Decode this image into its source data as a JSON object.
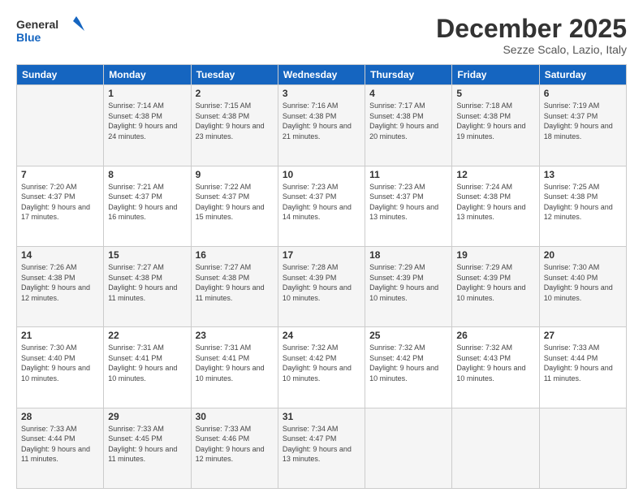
{
  "logo": {
    "line1": "General",
    "line2": "Blue"
  },
  "header": {
    "month": "December 2025",
    "location": "Sezze Scalo, Lazio, Italy"
  },
  "weekdays": [
    "Sunday",
    "Monday",
    "Tuesday",
    "Wednesday",
    "Thursday",
    "Friday",
    "Saturday"
  ],
  "weeks": [
    [
      {
        "day": null
      },
      {
        "day": 1,
        "sunrise": "7:14 AM",
        "sunset": "4:38 PM",
        "daylight": "9 hours and 24 minutes."
      },
      {
        "day": 2,
        "sunrise": "7:15 AM",
        "sunset": "4:38 PM",
        "daylight": "9 hours and 23 minutes."
      },
      {
        "day": 3,
        "sunrise": "7:16 AM",
        "sunset": "4:38 PM",
        "daylight": "9 hours and 21 minutes."
      },
      {
        "day": 4,
        "sunrise": "7:17 AM",
        "sunset": "4:38 PM",
        "daylight": "9 hours and 20 minutes."
      },
      {
        "day": 5,
        "sunrise": "7:18 AM",
        "sunset": "4:38 PM",
        "daylight": "9 hours and 19 minutes."
      },
      {
        "day": 6,
        "sunrise": "7:19 AM",
        "sunset": "4:37 PM",
        "daylight": "9 hours and 18 minutes."
      }
    ],
    [
      {
        "day": 7,
        "sunrise": "7:20 AM",
        "sunset": "4:37 PM",
        "daylight": "9 hours and 17 minutes."
      },
      {
        "day": 8,
        "sunrise": "7:21 AM",
        "sunset": "4:37 PM",
        "daylight": "9 hours and 16 minutes."
      },
      {
        "day": 9,
        "sunrise": "7:22 AM",
        "sunset": "4:37 PM",
        "daylight": "9 hours and 15 minutes."
      },
      {
        "day": 10,
        "sunrise": "7:23 AM",
        "sunset": "4:37 PM",
        "daylight": "9 hours and 14 minutes."
      },
      {
        "day": 11,
        "sunrise": "7:23 AM",
        "sunset": "4:37 PM",
        "daylight": "9 hours and 13 minutes."
      },
      {
        "day": 12,
        "sunrise": "7:24 AM",
        "sunset": "4:38 PM",
        "daylight": "9 hours and 13 minutes."
      },
      {
        "day": 13,
        "sunrise": "7:25 AM",
        "sunset": "4:38 PM",
        "daylight": "9 hours and 12 minutes."
      }
    ],
    [
      {
        "day": 14,
        "sunrise": "7:26 AM",
        "sunset": "4:38 PM",
        "daylight": "9 hours and 12 minutes."
      },
      {
        "day": 15,
        "sunrise": "7:27 AM",
        "sunset": "4:38 PM",
        "daylight": "9 hours and 11 minutes."
      },
      {
        "day": 16,
        "sunrise": "7:27 AM",
        "sunset": "4:38 PM",
        "daylight": "9 hours and 11 minutes."
      },
      {
        "day": 17,
        "sunrise": "7:28 AM",
        "sunset": "4:39 PM",
        "daylight": "9 hours and 10 minutes."
      },
      {
        "day": 18,
        "sunrise": "7:29 AM",
        "sunset": "4:39 PM",
        "daylight": "9 hours and 10 minutes."
      },
      {
        "day": 19,
        "sunrise": "7:29 AM",
        "sunset": "4:39 PM",
        "daylight": "9 hours and 10 minutes."
      },
      {
        "day": 20,
        "sunrise": "7:30 AM",
        "sunset": "4:40 PM",
        "daylight": "9 hours and 10 minutes."
      }
    ],
    [
      {
        "day": 21,
        "sunrise": "7:30 AM",
        "sunset": "4:40 PM",
        "daylight": "9 hours and 10 minutes."
      },
      {
        "day": 22,
        "sunrise": "7:31 AM",
        "sunset": "4:41 PM",
        "daylight": "9 hours and 10 minutes."
      },
      {
        "day": 23,
        "sunrise": "7:31 AM",
        "sunset": "4:41 PM",
        "daylight": "9 hours and 10 minutes."
      },
      {
        "day": 24,
        "sunrise": "7:32 AM",
        "sunset": "4:42 PM",
        "daylight": "9 hours and 10 minutes."
      },
      {
        "day": 25,
        "sunrise": "7:32 AM",
        "sunset": "4:42 PM",
        "daylight": "9 hours and 10 minutes."
      },
      {
        "day": 26,
        "sunrise": "7:32 AM",
        "sunset": "4:43 PM",
        "daylight": "9 hours and 10 minutes."
      },
      {
        "day": 27,
        "sunrise": "7:33 AM",
        "sunset": "4:44 PM",
        "daylight": "9 hours and 11 minutes."
      }
    ],
    [
      {
        "day": 28,
        "sunrise": "7:33 AM",
        "sunset": "4:44 PM",
        "daylight": "9 hours and 11 minutes."
      },
      {
        "day": 29,
        "sunrise": "7:33 AM",
        "sunset": "4:45 PM",
        "daylight": "9 hours and 11 minutes."
      },
      {
        "day": 30,
        "sunrise": "7:33 AM",
        "sunset": "4:46 PM",
        "daylight": "9 hours and 12 minutes."
      },
      {
        "day": 31,
        "sunrise": "7:34 AM",
        "sunset": "4:47 PM",
        "daylight": "9 hours and 13 minutes."
      },
      {
        "day": null
      },
      {
        "day": null
      },
      {
        "day": null
      }
    ]
  ]
}
